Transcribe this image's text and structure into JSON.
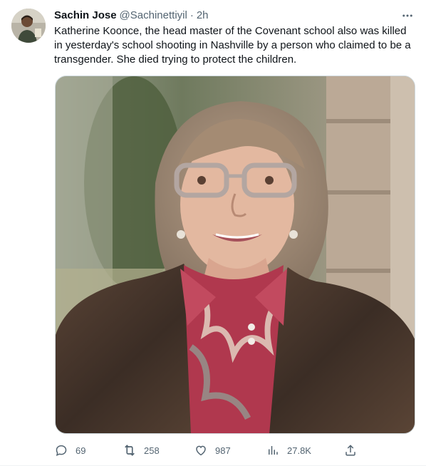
{
  "tweet": {
    "author": {
      "name": "Sachin Jose",
      "handle": "@Sachinettiyil",
      "separator": "·",
      "time": "2h"
    },
    "text": "Katherine Koonce, the head master of the Covenant school also was killed in yesterday's school shooting in Nashville by a person who claimed to be a transgender. She died trying to protect the children.",
    "media_icon": "photo",
    "actions": {
      "reply": {
        "icon": "reply-icon",
        "count": "69"
      },
      "retweet": {
        "icon": "retweet-icon",
        "count": "258"
      },
      "like": {
        "icon": "like-icon",
        "count": "987"
      },
      "views": {
        "icon": "views-icon",
        "count": "27.8K"
      },
      "share": {
        "icon": "share-icon"
      }
    }
  },
  "colors": {
    "text_primary": "#0f1419",
    "text_secondary": "#536471",
    "border": "#cfd9de"
  }
}
